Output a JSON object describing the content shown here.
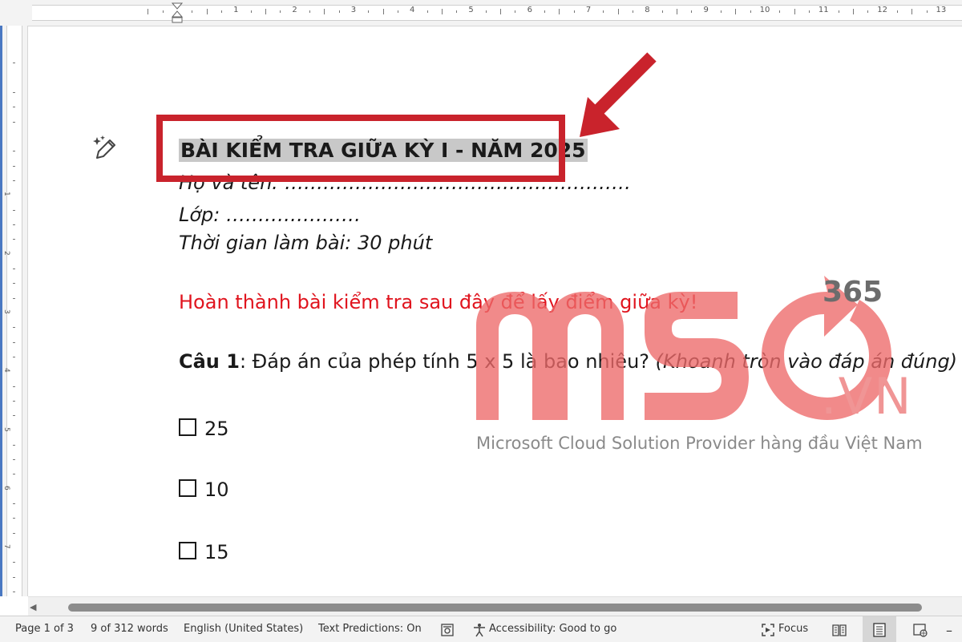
{
  "ruler": {
    "numbers": [
      "1",
      "2",
      "3",
      "4",
      "5",
      "6",
      "7",
      "8",
      "9",
      "10",
      "11",
      "12",
      "13"
    ],
    "vertical_numbers": [
      "1",
      "2",
      "3",
      "4",
      "5",
      "6",
      "7"
    ]
  },
  "document": {
    "title": "BÀI KIỂM TRA GIỮA KỲ I - NĂM 2025",
    "name_line": "Họ và tên: ………………………………………………",
    "class_line": "Lớp: …………………",
    "time_line": "Thời gian làm bài: 30 phút",
    "instruction": "Hoàn thành bài kiểm tra sau đây để lấy điểm giữa kỳ!",
    "question1": {
      "label": "Câu 1",
      "text": ": Đáp án của phép tính 5 x 5 là bao nhiêu? ",
      "hint": "(Khoanh tròn vào đáp án đúng)"
    },
    "options": [
      "25",
      "10",
      "15"
    ]
  },
  "watermark": {
    "suffix": "365",
    "domain": ".VN",
    "tagline": "Microsoft Cloud Solution Provider hàng đầu Việt Nam",
    "color": "#f08080"
  },
  "statusbar": {
    "page": "Page 1 of 3",
    "words": "9 of 312 words",
    "language": "English (United States)",
    "text_predictions": "Text Predictions: On",
    "accessibility": "Accessibility: Good to go",
    "focus": "Focus",
    "zoom_out": "–"
  },
  "colors": {
    "highlight_box": "#c9232c",
    "instruction_text": "#e0141e",
    "title_highlight": "#c8c8c8"
  }
}
